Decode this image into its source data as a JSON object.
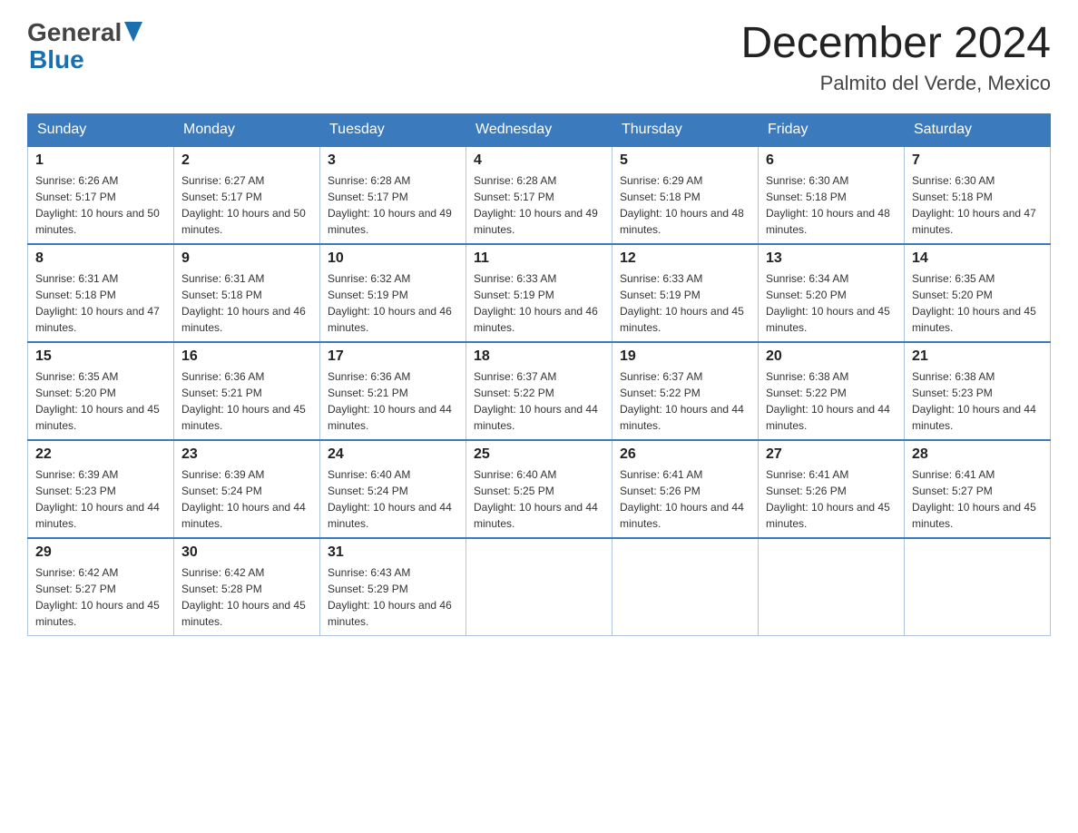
{
  "header": {
    "month_year": "December 2024",
    "location": "Palmito del Verde, Mexico",
    "logo_general": "General",
    "logo_blue": "Blue"
  },
  "weekdays": [
    "Sunday",
    "Monday",
    "Tuesday",
    "Wednesday",
    "Thursday",
    "Friday",
    "Saturday"
  ],
  "weeks": [
    [
      {
        "day": "1",
        "sunrise": "Sunrise: 6:26 AM",
        "sunset": "Sunset: 5:17 PM",
        "daylight": "Daylight: 10 hours and 50 minutes."
      },
      {
        "day": "2",
        "sunrise": "Sunrise: 6:27 AM",
        "sunset": "Sunset: 5:17 PM",
        "daylight": "Daylight: 10 hours and 50 minutes."
      },
      {
        "day": "3",
        "sunrise": "Sunrise: 6:28 AM",
        "sunset": "Sunset: 5:17 PM",
        "daylight": "Daylight: 10 hours and 49 minutes."
      },
      {
        "day": "4",
        "sunrise": "Sunrise: 6:28 AM",
        "sunset": "Sunset: 5:17 PM",
        "daylight": "Daylight: 10 hours and 49 minutes."
      },
      {
        "day": "5",
        "sunrise": "Sunrise: 6:29 AM",
        "sunset": "Sunset: 5:18 PM",
        "daylight": "Daylight: 10 hours and 48 minutes."
      },
      {
        "day": "6",
        "sunrise": "Sunrise: 6:30 AM",
        "sunset": "Sunset: 5:18 PM",
        "daylight": "Daylight: 10 hours and 48 minutes."
      },
      {
        "day": "7",
        "sunrise": "Sunrise: 6:30 AM",
        "sunset": "Sunset: 5:18 PM",
        "daylight": "Daylight: 10 hours and 47 minutes."
      }
    ],
    [
      {
        "day": "8",
        "sunrise": "Sunrise: 6:31 AM",
        "sunset": "Sunset: 5:18 PM",
        "daylight": "Daylight: 10 hours and 47 minutes."
      },
      {
        "day": "9",
        "sunrise": "Sunrise: 6:31 AM",
        "sunset": "Sunset: 5:18 PM",
        "daylight": "Daylight: 10 hours and 46 minutes."
      },
      {
        "day": "10",
        "sunrise": "Sunrise: 6:32 AM",
        "sunset": "Sunset: 5:19 PM",
        "daylight": "Daylight: 10 hours and 46 minutes."
      },
      {
        "day": "11",
        "sunrise": "Sunrise: 6:33 AM",
        "sunset": "Sunset: 5:19 PM",
        "daylight": "Daylight: 10 hours and 46 minutes."
      },
      {
        "day": "12",
        "sunrise": "Sunrise: 6:33 AM",
        "sunset": "Sunset: 5:19 PM",
        "daylight": "Daylight: 10 hours and 45 minutes."
      },
      {
        "day": "13",
        "sunrise": "Sunrise: 6:34 AM",
        "sunset": "Sunset: 5:20 PM",
        "daylight": "Daylight: 10 hours and 45 minutes."
      },
      {
        "day": "14",
        "sunrise": "Sunrise: 6:35 AM",
        "sunset": "Sunset: 5:20 PM",
        "daylight": "Daylight: 10 hours and 45 minutes."
      }
    ],
    [
      {
        "day": "15",
        "sunrise": "Sunrise: 6:35 AM",
        "sunset": "Sunset: 5:20 PM",
        "daylight": "Daylight: 10 hours and 45 minutes."
      },
      {
        "day": "16",
        "sunrise": "Sunrise: 6:36 AM",
        "sunset": "Sunset: 5:21 PM",
        "daylight": "Daylight: 10 hours and 45 minutes."
      },
      {
        "day": "17",
        "sunrise": "Sunrise: 6:36 AM",
        "sunset": "Sunset: 5:21 PM",
        "daylight": "Daylight: 10 hours and 44 minutes."
      },
      {
        "day": "18",
        "sunrise": "Sunrise: 6:37 AM",
        "sunset": "Sunset: 5:22 PM",
        "daylight": "Daylight: 10 hours and 44 minutes."
      },
      {
        "day": "19",
        "sunrise": "Sunrise: 6:37 AM",
        "sunset": "Sunset: 5:22 PM",
        "daylight": "Daylight: 10 hours and 44 minutes."
      },
      {
        "day": "20",
        "sunrise": "Sunrise: 6:38 AM",
        "sunset": "Sunset: 5:22 PM",
        "daylight": "Daylight: 10 hours and 44 minutes."
      },
      {
        "day": "21",
        "sunrise": "Sunrise: 6:38 AM",
        "sunset": "Sunset: 5:23 PM",
        "daylight": "Daylight: 10 hours and 44 minutes."
      }
    ],
    [
      {
        "day": "22",
        "sunrise": "Sunrise: 6:39 AM",
        "sunset": "Sunset: 5:23 PM",
        "daylight": "Daylight: 10 hours and 44 minutes."
      },
      {
        "day": "23",
        "sunrise": "Sunrise: 6:39 AM",
        "sunset": "Sunset: 5:24 PM",
        "daylight": "Daylight: 10 hours and 44 minutes."
      },
      {
        "day": "24",
        "sunrise": "Sunrise: 6:40 AM",
        "sunset": "Sunset: 5:24 PM",
        "daylight": "Daylight: 10 hours and 44 minutes."
      },
      {
        "day": "25",
        "sunrise": "Sunrise: 6:40 AM",
        "sunset": "Sunset: 5:25 PM",
        "daylight": "Daylight: 10 hours and 44 minutes."
      },
      {
        "day": "26",
        "sunrise": "Sunrise: 6:41 AM",
        "sunset": "Sunset: 5:26 PM",
        "daylight": "Daylight: 10 hours and 44 minutes."
      },
      {
        "day": "27",
        "sunrise": "Sunrise: 6:41 AM",
        "sunset": "Sunset: 5:26 PM",
        "daylight": "Daylight: 10 hours and 45 minutes."
      },
      {
        "day": "28",
        "sunrise": "Sunrise: 6:41 AM",
        "sunset": "Sunset: 5:27 PM",
        "daylight": "Daylight: 10 hours and 45 minutes."
      }
    ],
    [
      {
        "day": "29",
        "sunrise": "Sunrise: 6:42 AM",
        "sunset": "Sunset: 5:27 PM",
        "daylight": "Daylight: 10 hours and 45 minutes."
      },
      {
        "day": "30",
        "sunrise": "Sunrise: 6:42 AM",
        "sunset": "Sunset: 5:28 PM",
        "daylight": "Daylight: 10 hours and 45 minutes."
      },
      {
        "day": "31",
        "sunrise": "Sunrise: 6:43 AM",
        "sunset": "Sunset: 5:29 PM",
        "daylight": "Daylight: 10 hours and 46 minutes."
      },
      null,
      null,
      null,
      null
    ]
  ]
}
